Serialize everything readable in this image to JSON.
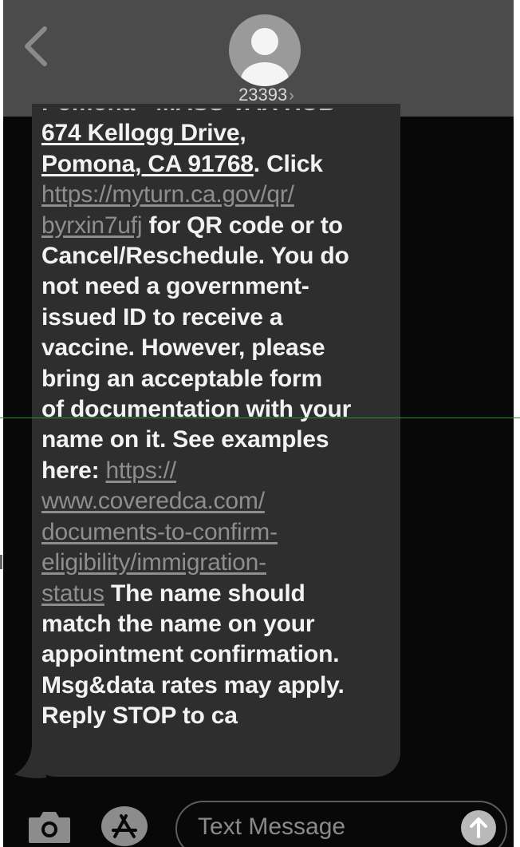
{
  "header": {
    "contact_number": "23393",
    "contact_chevron": "›",
    "back_icon": "chevron-left-icon",
    "avatar_icon": "person-silhouette-icon"
  },
  "message": {
    "cut_top_line": "Pomona - MASS VAX HUB",
    "address_line1": "674 Kellogg Drive,",
    "address_line2": "Pomona, CA 91768",
    "click_text": ". Click",
    "link1_part1": "https://myturn.ca.gov/qr/",
    "link1_part2": "byrxin7ufj",
    "after_link1": " for QR code or to",
    "line5": "Cancel/Reschedule. You do",
    "line6": "not need a government-",
    "line7": "issued ID to receive a",
    "line8": "vaccine. However, please",
    "line9": "bring an acceptable form",
    "line10": "of documentation with your",
    "line11": "name on it. See examples",
    "here_text": "here: ",
    "link2_part1": "https://",
    "link2_part2": "www.coveredca.com/",
    "link2_part3": "documents-to-confirm-",
    "link2_part4": "eligibility/immigration-",
    "link2_part5": "status",
    "after_link2": " The name should",
    "line18": "match the name on your",
    "line19": "appointment confirmation.",
    "line20": "Msg&data rates may apply.",
    "line21": "Reply STOP to ca"
  },
  "input_bar": {
    "placeholder": "Text Message",
    "camera_icon": "camera-icon",
    "appstore_icon": "app-store-icon",
    "send_icon": "arrow-up-icon"
  },
  "colors": {
    "background": "#080808",
    "header": "#4b4b4b",
    "bubble": "#2e2e2e",
    "text": "#f2f2f2",
    "link": "#8e8e8e"
  }
}
